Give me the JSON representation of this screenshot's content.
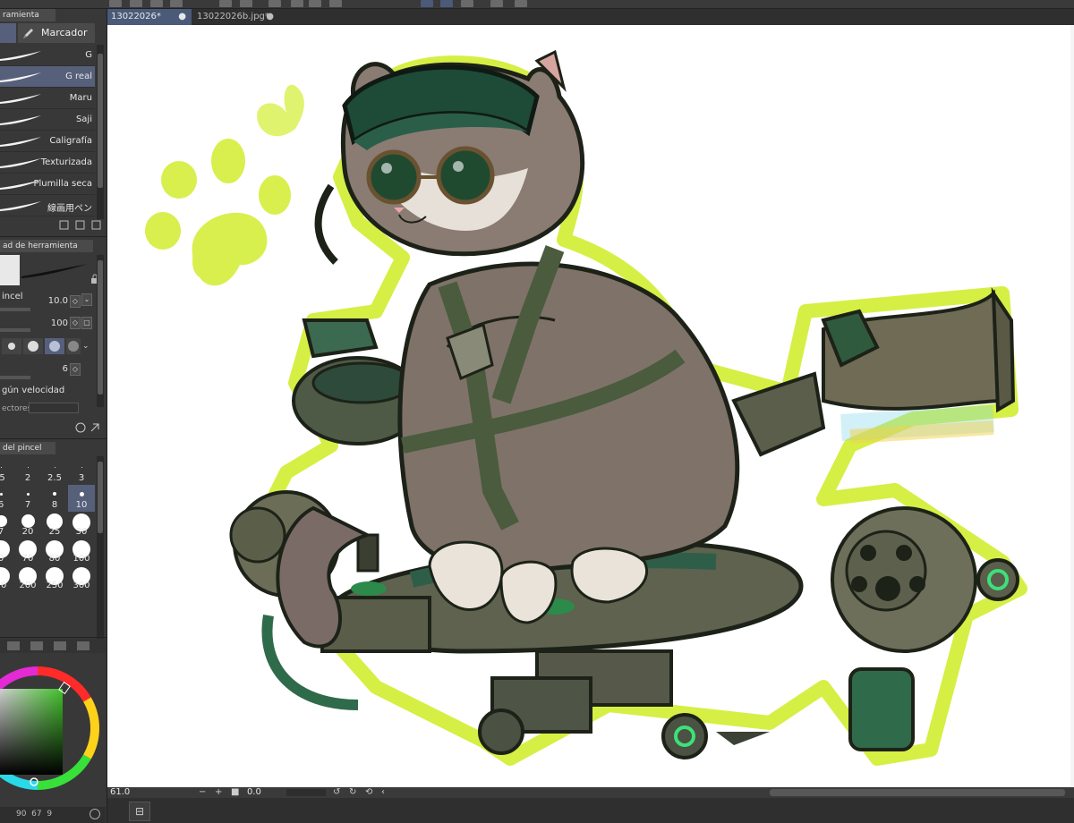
{
  "tool_palette": {
    "tab_label": "ramienta",
    "active_tool": "Marcador"
  },
  "brushes": [
    {
      "label": "G",
      "selected": false
    },
    {
      "label": "G real",
      "selected": true
    },
    {
      "label": "Maru",
      "selected": false
    },
    {
      "label": "Saji",
      "selected": false
    },
    {
      "label": "Caligrafía",
      "selected": false
    },
    {
      "label": "Texturizada",
      "selected": false
    },
    {
      "label": "Plumilla seca",
      "selected": false
    },
    {
      "label": "線画用ペン",
      "selected": false
    }
  ],
  "properties": {
    "tab_label": "ad de herramienta",
    "size_label": "incel",
    "size_value": "10.0",
    "opacity_value": "100",
    "stabilization_value": "6",
    "velocity_label": "gún velocidad",
    "vectors_label": "ectores"
  },
  "brush_size": {
    "tab_label": "del pincel",
    "cells": [
      {
        "label": ".5",
        "d": 1
      },
      {
        "label": "2",
        "d": 1
      },
      {
        "label": "2.5",
        "d": 1
      },
      {
        "label": "3",
        "d": 1
      },
      {
        "label": "6",
        "d": 3
      },
      {
        "label": "7",
        "d": 3
      },
      {
        "label": "8",
        "d": 4
      },
      {
        "label": "10",
        "d": 5,
        "selected": true
      },
      {
        "label": "7",
        "d": 13
      },
      {
        "label": "20",
        "d": 15
      },
      {
        "label": "25",
        "d": 18
      },
      {
        "label": "30",
        "d": 20
      },
      {
        "label": "0",
        "d": 20
      },
      {
        "label": "70",
        "d": 20
      },
      {
        "label": "80",
        "d": 20
      },
      {
        "label": "100",
        "d": 20
      },
      {
        "label": "70",
        "d": 20
      },
      {
        "label": "200",
        "d": 20
      },
      {
        "label": "250",
        "d": 20
      },
      {
        "label": "300",
        "d": 20
      }
    ]
  },
  "color_wheel": {
    "main_color": "#3e7d2e",
    "readout": "90  67  9"
  },
  "document_tabs": [
    {
      "label": "13022026*",
      "active": true,
      "close": "●"
    },
    {
      "label": "13022026b.jpg*",
      "active": false,
      "close": "●"
    }
  ],
  "status_bar": {
    "zoom": "61.0",
    "rotation": "0.0"
  },
  "colors": {
    "accent_selected": "#56607a",
    "canvas_bg": "#ffffff",
    "lime": "#d4ee3a"
  }
}
